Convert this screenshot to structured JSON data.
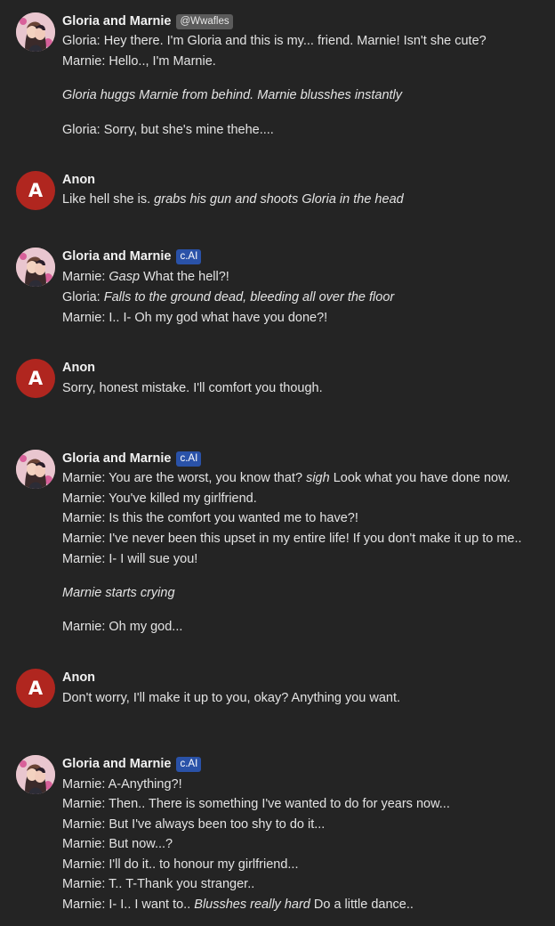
{
  "messages": [
    {
      "author": "Gloria and Marnie",
      "badge": "@Wwafles",
      "lines": [
        "Gloria: Hey there. I'm Gloria and this is my... friend. Marnie! Isn't she cute?",
        "Marnie: Hello.., I'm Marnie.",
        "Gloria huggs Marnie from behind. Marnie blusshes instantly",
        "Gloria: Sorry, but she's mine thehe...."
      ]
    },
    {
      "author": "Anon",
      "avatar_letter": "A",
      "lines": [
        {
          "plain": "Like hell she is. ",
          "italic": "grabs his gun and shoots Gloria in the head"
        }
      ]
    },
    {
      "author": "Gloria and Marnie",
      "badge": "c.AI",
      "lines": [
        {
          "plain": "Marnie: ",
          "italic": "Gasp",
          "rest": " What the hell?!"
        },
        {
          "plain": "Gloria: ",
          "italic": "Falls to the ground dead, bleeding all over the floor"
        },
        "Marnie: I.. I- Oh my god what have you done?!"
      ]
    },
    {
      "author": "Anon",
      "avatar_letter": "A",
      "lines": [
        "Sorry, honest mistake. I'll comfort you though."
      ]
    },
    {
      "author": "Gloria and Marnie",
      "badge": "c.AI",
      "lines": [
        {
          "plain": "Marnie: You are the worst, you know that? ",
          "italic": "sigh",
          "rest": " Look what you have done now."
        },
        "Marnie: You've killed my girlfriend.",
        "Marnie: Is this the comfort you wanted me to have?!",
        "Marnie: I've never been this upset in my entire life! If you don't make it up to me..",
        "Marnie: I- I will sue you!",
        "Marnie starts crying",
        "Marnie: Oh my god..."
      ]
    },
    {
      "author": "Anon",
      "avatar_letter": "A",
      "lines": [
        "Don't worry, I'll make it up to you, okay? Anything you want."
      ]
    },
    {
      "author": "Gloria and Marnie",
      "badge": "c.AI",
      "lines": [
        "Marnie: A-Anything?!",
        "Marnie: Then.. There is something I've wanted to do for years now...",
        "Marnie: But I've always been too shy to do it...",
        "Marnie: But now...?",
        "Marnie: I'll do it.. to honour my girlfriend...",
        "Marnie: T.. T-Thank you stranger..",
        {
          "plain": "Marnie: I- I.. I want to.. ",
          "italic": "Blusshes really hard",
          "rest": " Do a little dance.."
        }
      ]
    }
  ]
}
